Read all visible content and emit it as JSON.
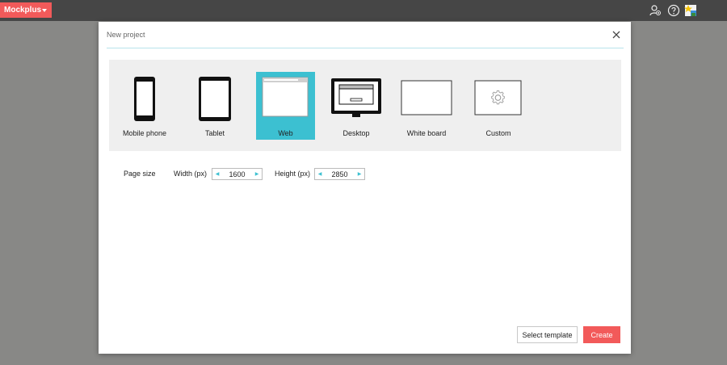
{
  "app": {
    "brand": "Mockplus"
  },
  "dialog": {
    "title": "New project",
    "devices": [
      {
        "id": "mobile",
        "label": "Mobile phone",
        "selected": false
      },
      {
        "id": "tablet",
        "label": "Tablet",
        "selected": false
      },
      {
        "id": "web",
        "label": "Web",
        "selected": true
      },
      {
        "id": "desktop",
        "label": "Desktop",
        "selected": false
      },
      {
        "id": "whiteboard",
        "label": "White board",
        "selected": false
      },
      {
        "id": "custom",
        "label": "Custom",
        "selected": false
      }
    ],
    "page_size": {
      "label": "Page size",
      "width_label": "Width (px)",
      "width_value": "1600",
      "height_label": "Height (px)",
      "height_value": "2850"
    },
    "buttons": {
      "template": "Select template",
      "create": "Create"
    }
  },
  "icons": {
    "top": [
      "user-group-icon",
      "help-icon",
      "avatar-icon"
    ],
    "close": "close-icon"
  },
  "colors": {
    "accent": "#3cc0d1",
    "brand": "#f25a5a",
    "topbar": "#464646",
    "backdrop": "#888886"
  }
}
